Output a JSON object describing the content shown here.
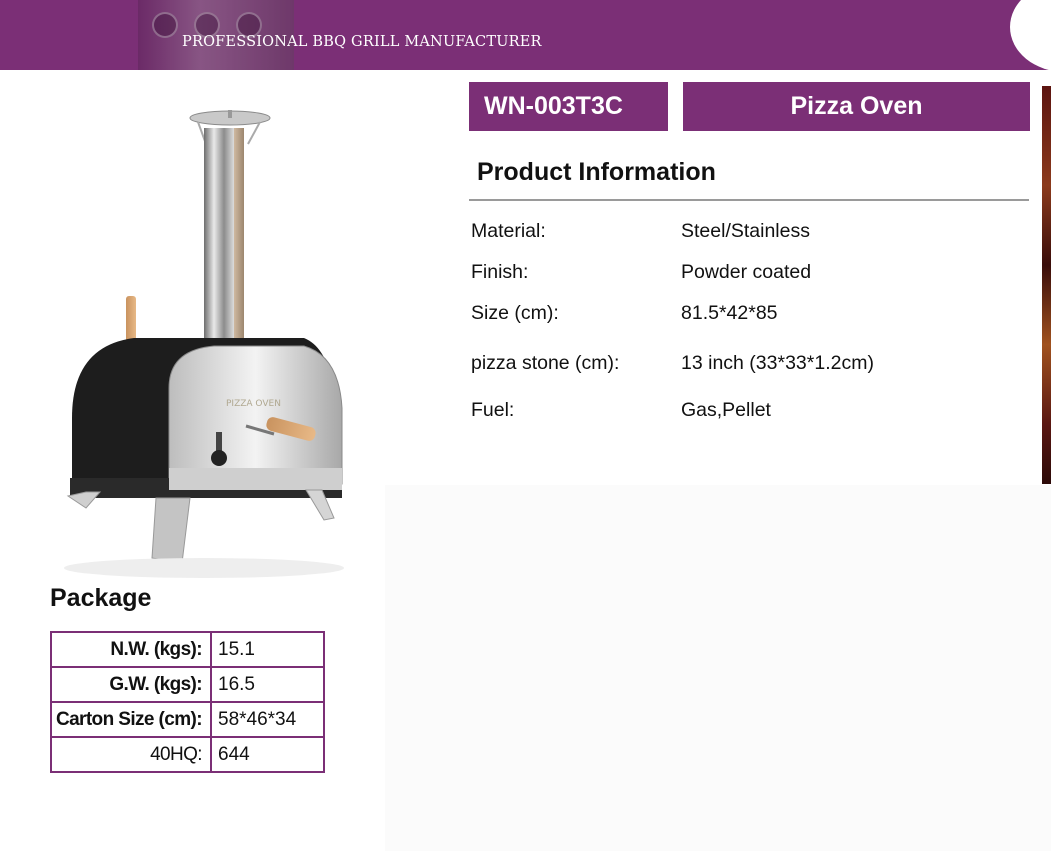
{
  "header": {
    "tagline": "PROFESSIONAL BBQ GRILL MANUFACTURER",
    "brand_color": "#7b2f76"
  },
  "product": {
    "model": "WN-003T3C",
    "name": "Pizza Oven",
    "image_label": "PIZZA OVEN"
  },
  "info": {
    "title": "Product Information",
    "specs": [
      {
        "label": "Material:",
        "value": "Steel/Stainless"
      },
      {
        "label": "Finish:",
        "value": "Powder coated"
      },
      {
        "label": "Size (cm):",
        "value": "81.5*42*85"
      },
      {
        "label": "pizza stone (cm):",
        "value": "13 inch (33*33*1.2cm)"
      },
      {
        "label": "Fuel:",
        "value": "Gas,Pellet"
      }
    ]
  },
  "package": {
    "title": "Package",
    "rows": [
      {
        "label": "N.W. (kgs):",
        "value": "15.1"
      },
      {
        "label": "G.W. (kgs):",
        "value": "16.5"
      },
      {
        "label": "Carton Size (cm):",
        "value": "58*46*34"
      },
      {
        "label": "40HQ:",
        "value": "644"
      }
    ]
  }
}
